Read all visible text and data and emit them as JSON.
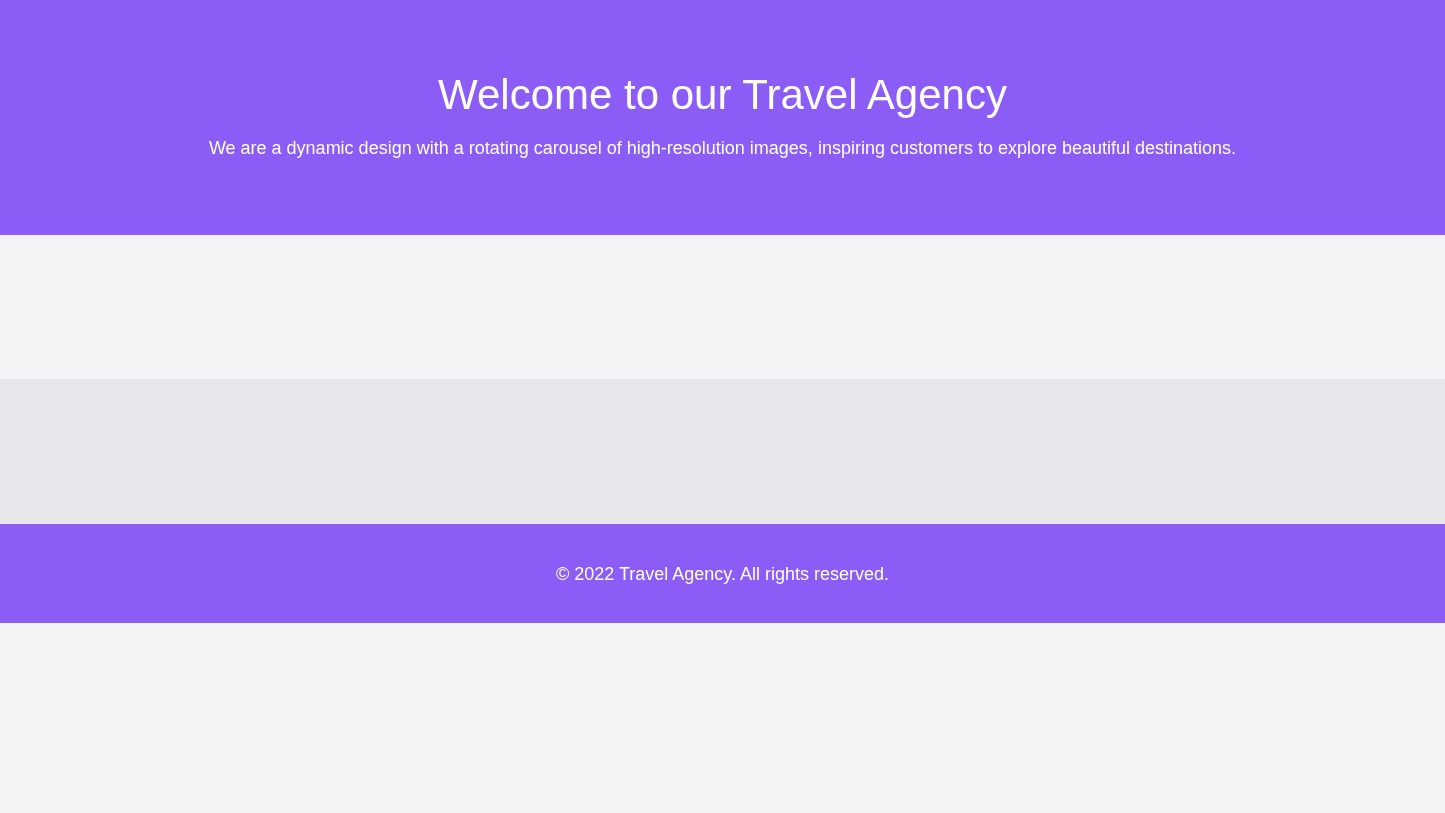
{
  "header": {
    "title": "Welcome to our Travel Agency",
    "subtitle": "We are a dynamic design with a rotating carousel of high-resolution images, inspiring customers to explore beautiful destinations."
  },
  "footer": {
    "text": "© 2022 Travel Agency. All rights reserved."
  }
}
